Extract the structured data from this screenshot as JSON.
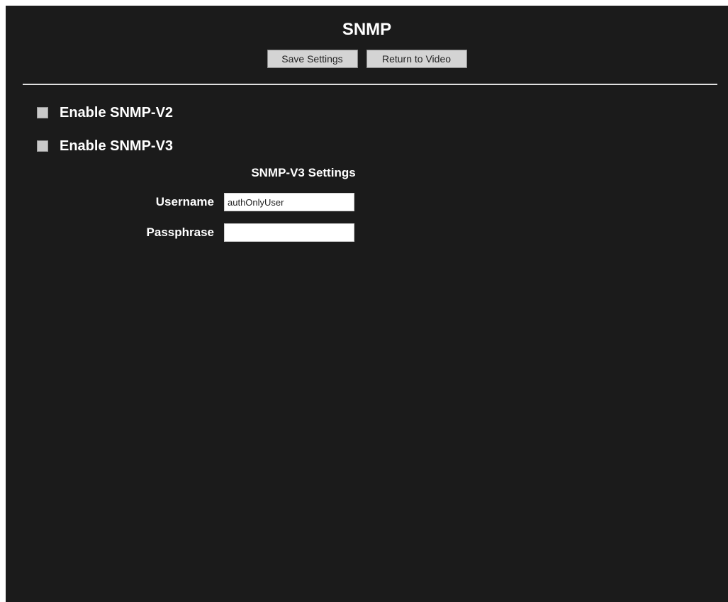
{
  "page": {
    "title": "SNMP"
  },
  "toolbar": {
    "save_label": "Save Settings",
    "return_label": "Return to Video"
  },
  "options": {
    "snmp_v2": {
      "label": "Enable SNMP-V2",
      "checked": false
    },
    "snmp_v3": {
      "label": "Enable SNMP-V3",
      "checked": false
    }
  },
  "v3_settings": {
    "heading": "SNMP-V3 Settings",
    "username_label": "Username",
    "username_value": "authOnlyUser",
    "passphrase_label": "Passphrase",
    "passphrase_value": ""
  },
  "colors": {
    "background": "#1b1b1b",
    "text": "#ffffff",
    "button": "#d4d4d4",
    "divider": "#e0e0e0"
  }
}
